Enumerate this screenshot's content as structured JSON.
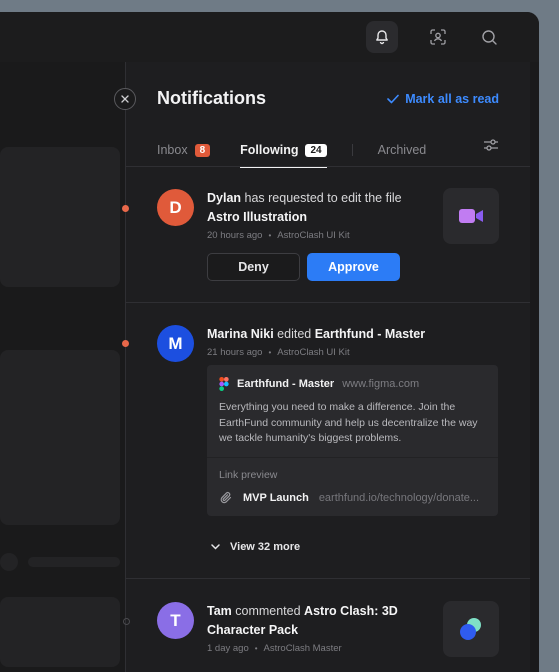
{
  "panel": {
    "title": "Notifications",
    "mark_all_label": "Mark all as read"
  },
  "tabs": [
    {
      "label": "Inbox",
      "badge": "8"
    },
    {
      "label": "Following",
      "badge": "24"
    },
    {
      "label": "Archived"
    }
  ],
  "notifications": [
    {
      "avatar": "D",
      "avatar_color": "#e05a3a",
      "actor": "Dylan",
      "action": " has requested to edit the file",
      "target": "Astro Illustration",
      "time": "20 hours ago",
      "source": "AstroClash UI Kit",
      "deny_label": "Deny",
      "approve_label": "Approve",
      "thumb_icon": "video-camera-icon"
    },
    {
      "avatar": "M",
      "avatar_color": "#1c4fe0",
      "actor": "Marina Niki",
      "action": " edited ",
      "target": "Earthfund - Master",
      "time": "21 hours ago",
      "source": "AstroClash UI Kit",
      "card": {
        "title": "Earthfund - Master",
        "url": "www.figma.com",
        "desc": "Everything you need to make a difference. Join the EarthFund community and help us decentralize the way we tackle humanity's biggest problems.",
        "link_preview_label": "Link preview",
        "link_name": "MVP Launch",
        "link_url": "earthfund.io/technology/donate..."
      },
      "view_more": "View 32 more"
    },
    {
      "avatar": "T",
      "avatar_color": "#8a6ee6",
      "actor": "Tam",
      "action": " commented ",
      "target": "Astro Clash: 3D Character Pack",
      "time": "1 day ago",
      "source": "AstroClash Master",
      "thumb_icon": "3d-shapes-icon"
    }
  ],
  "colors": {
    "accent": "#2c7cf6",
    "unread_dot": "#e8684a",
    "inbox_badge": "#e05a3a"
  }
}
